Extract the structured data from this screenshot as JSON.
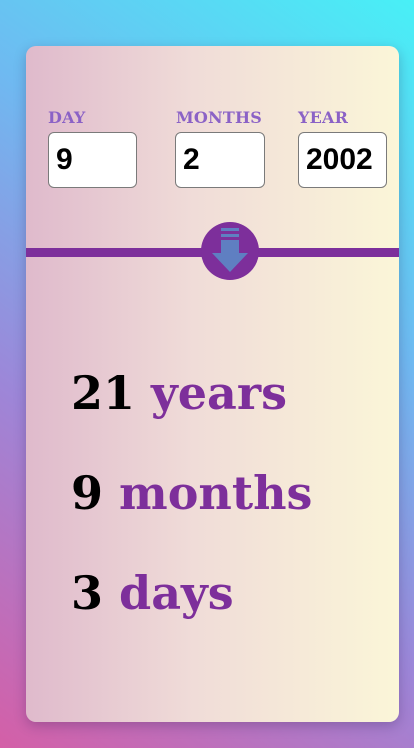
{
  "form": {
    "day": {
      "label": "DAY",
      "value": "9"
    },
    "months": {
      "label": "MONTHS",
      "value": "2"
    },
    "year": {
      "label": "YEAR",
      "value": "2002"
    }
  },
  "submit": {
    "icon": "arrow-down-icon"
  },
  "result": {
    "years": {
      "value": "21",
      "unit": "years"
    },
    "months": {
      "value": "9",
      "unit": "months"
    },
    "days": {
      "value": "3",
      "unit": "days"
    }
  },
  "colors": {
    "accent": "#7d2f9b",
    "label": "#8b62c6"
  }
}
